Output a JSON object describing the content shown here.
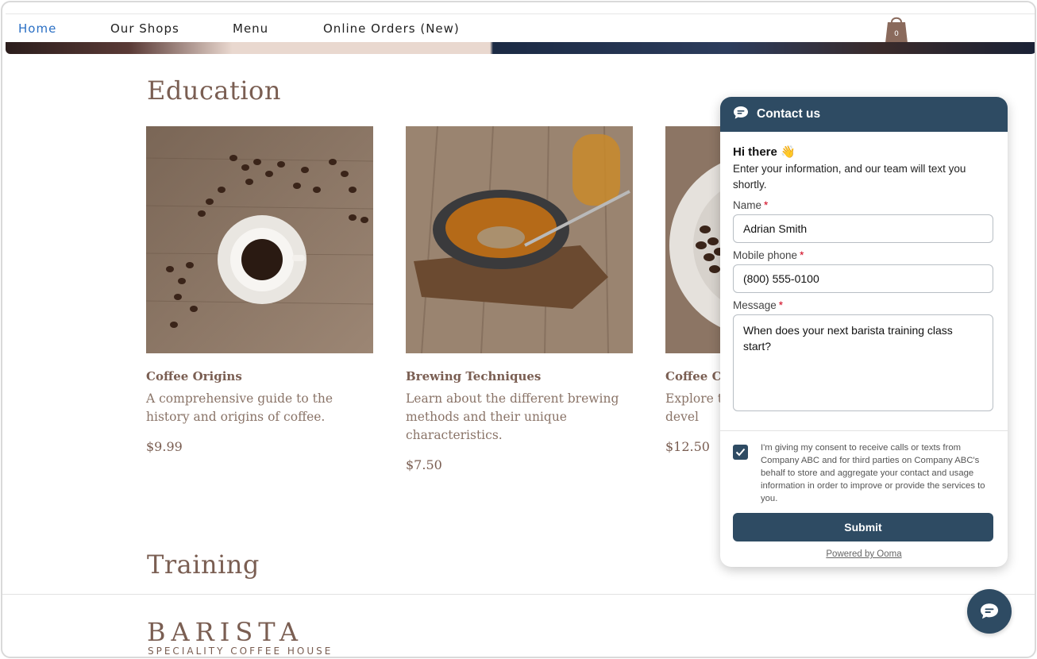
{
  "nav": {
    "items": [
      {
        "label": "Home",
        "active": true
      },
      {
        "label": "Our Shops",
        "active": false
      },
      {
        "label": "Menu",
        "active": false
      },
      {
        "label": "Online Orders (New)",
        "active": false
      }
    ],
    "cart_icon": "shopping-bag-icon",
    "cart_count": "0"
  },
  "education": {
    "title": "Education",
    "cards": [
      {
        "name": "Coffee Origins",
        "description": "A comprehensive guide to the history and origins of coffee.",
        "price": "$9.99"
      },
      {
        "name": "Brewing Techniques",
        "description": "Learn about the different brewing methods and their unique characteristics.",
        "price": "$7.50"
      },
      {
        "name": "Coffee Cu",
        "description": "Explore t and devel",
        "price": "$12.50"
      }
    ]
  },
  "training": {
    "title": "Training"
  },
  "footer": {
    "brand": "BARISTA",
    "tagline": "SPECIALITY COFFEE HOUSE"
  },
  "widget": {
    "header_title": "Contact us",
    "greeting": "Hi there 👋",
    "intro": "Enter your information, and our team will text you shortly.",
    "name_label": "Name",
    "name_value": "Adrian Smith",
    "phone_label": "Mobile phone",
    "phone_value": "(800) 555-0100",
    "message_label": "Message",
    "message_value": "When does your next barista training class start?",
    "required_mark": "*",
    "consent_checked": true,
    "consent_text": "I'm giving my consent to receive calls or texts from Company ABC and for third parties on Company ABC's behalf to store and aggregate your contact and usage information in order to improve or provide the services to you.",
    "submit_label": "Submit",
    "powered_by": "Powered by Ooma"
  },
  "colors": {
    "brand_brown": "#7a5e52",
    "widget_navy": "#2e4b63",
    "nav_active": "#2a6fc4",
    "required": "#d0021b"
  }
}
